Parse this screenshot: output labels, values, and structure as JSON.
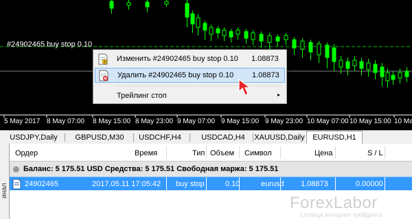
{
  "chart": {
    "order_line_label": "#24902465 buy stop 0.10",
    "dates": [
      "5 May 2017",
      "8 May 07:00",
      "8 May 15:00",
      "8 May 23:00",
      "9 May 07:00",
      "9 May 15:00",
      "9 May 23:00",
      "10 May 07:00",
      "10 May 15:00",
      "10 May"
    ],
    "colors": {
      "background": "#000000",
      "candles": "#00ff00",
      "order_line": "#00c800",
      "grid": "#ffffff"
    }
  },
  "context_menu": {
    "items": [
      {
        "label": "Изменить #24902465 buy stop 0.10",
        "price": "1.08873",
        "icon": "order-edit-icon"
      },
      {
        "label": "Удалить #24902465 buy stop 0.10",
        "price": "1.08873",
        "icon": "order-delete-icon"
      },
      {
        "label": "Трейлинг стоп",
        "price": "",
        "icon": ""
      }
    ],
    "submenu_arrow": "▸"
  },
  "tabs": [
    {
      "label": "USDJPY,Daily",
      "active": false
    },
    {
      "label": "GBPUSD,M30",
      "active": false
    },
    {
      "label": "USDCHF,H4",
      "active": false
    },
    {
      "label": "USDCAD,H4",
      "active": false
    },
    {
      "label": "XAUUSD,Daily",
      "active": false
    },
    {
      "label": "EURUSD,H1",
      "active": true
    }
  ],
  "terminal": {
    "side_label": "инал",
    "columns": [
      "Ордер",
      "Время",
      "Тип",
      "Объем",
      "Символ",
      "Цена",
      "S / L"
    ],
    "balance_row": "Баланс: 5 175.51 USD  Средства: 5 175.51  Свободная маржа: 5 175.51",
    "order": {
      "ticket": "24902465",
      "time": "2017.05.11 17:05:42",
      "type": "buy stop",
      "volume": "0.10",
      "symbol": "eurusd",
      "price": "1.08873",
      "sl": "0.00000"
    }
  },
  "watermark": {
    "title": "ForexLabor",
    "subtitle": "столица интернет трейдинга"
  }
}
